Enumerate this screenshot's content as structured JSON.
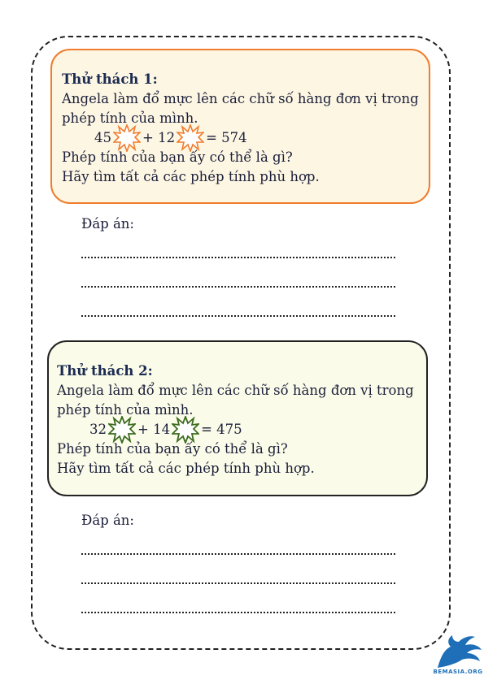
{
  "challenge1": {
    "title": "Thử thách 1:",
    "line1": "Angela làm đổ mực lên các chữ số hàng đơn vị trong",
    "line2": "phép tính của mình.",
    "eq_a": "45",
    "eq_op": "+ 12",
    "eq_res": "= 574",
    "line3": "Phép tính của bạn ấy có thể là gì?",
    "line4": "Hãy tìm tất cả các phép tính phù hợp.",
    "splat_color": "#f07c2c"
  },
  "challenge2": {
    "title": "Thử thách 2:",
    "line1": "Angela làm đổ mực lên các chữ số hàng đơn vị trong",
    "line2": "phép tính của mình.",
    "eq_a": "32",
    "eq_op": "+ 14",
    "eq_res": "= 475",
    "line3": "Phép tính của bạn ấy có thể là gì?",
    "line4": "Hãy tìm tất cả các phép tính phù hợp.",
    "splat_color": "#3b6b1e"
  },
  "answer_label": "Đáp án:",
  "logo_text": "BEMASIA.ORG"
}
